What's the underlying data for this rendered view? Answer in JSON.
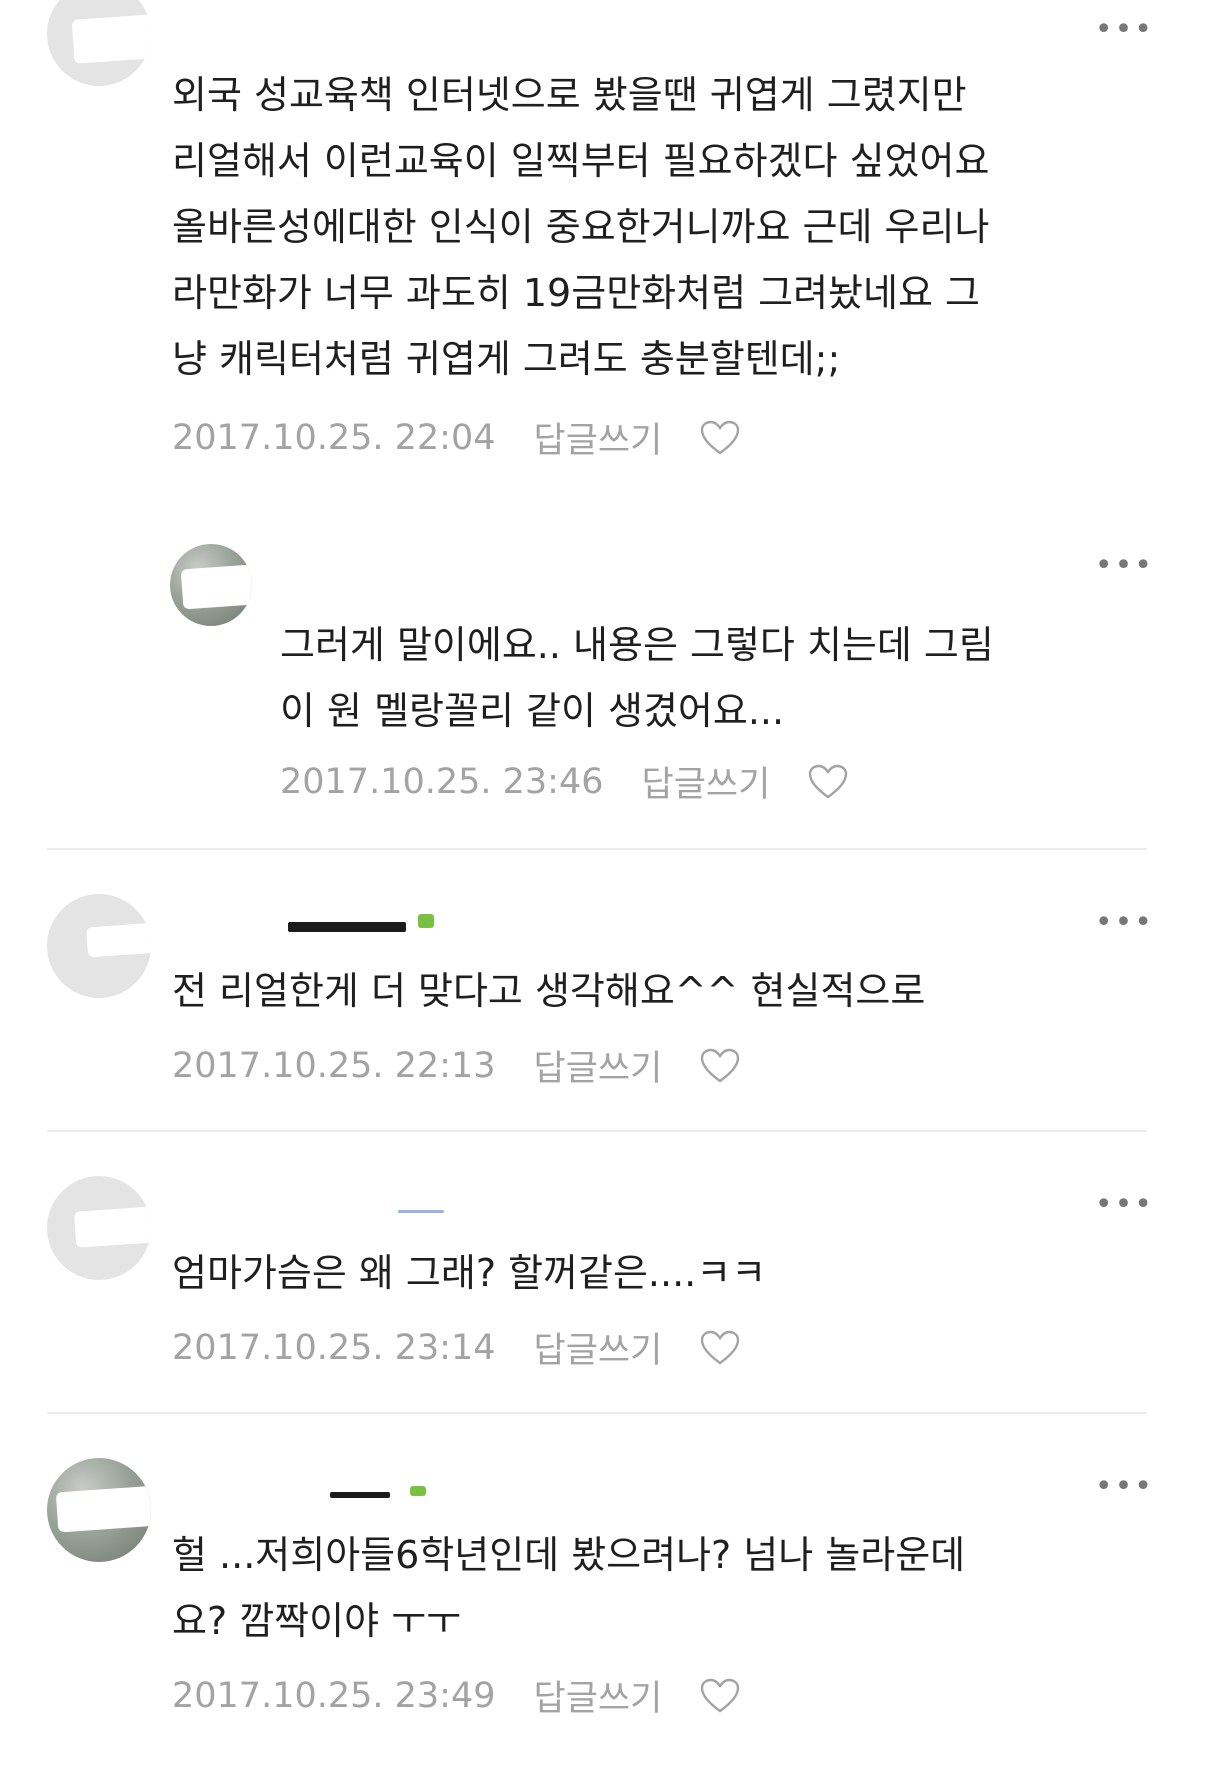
{
  "comments": [
    {
      "text": "외국 성교육책 인터넷으로 봤을땐 귀엽게 그렸지만\n리얼해서 이런교육이 일찍부터 필요하겠다 싶었어요\n올바른성에대한 인식이 중요한거니까요 근데 우리나\n라만화가 너무 과도히 19금만화처럼 그려놨네요 그\n냥 캐릭터처럼 귀엽게 그려도 충분할텐데;;",
      "date": "2017.10.25. 22:04",
      "reply_label": "답글쓰기",
      "more_label": "•••"
    },
    {
      "text": "그러게 말이에요.. 내용은 그렇다 치는데 그림\n이 원 멜랑꼴리 같이 생겼어요...",
      "date": "2017.10.25. 23:46",
      "reply_label": "답글쓰기",
      "more_label": "•••"
    },
    {
      "text": "전 리얼한게 더 맞다고 생각해요^^ 현실적으로",
      "date": "2017.10.25. 22:13",
      "reply_label": "답글쓰기",
      "more_label": "•••"
    },
    {
      "text": "엄마가슴은 왜 그래? 할꺼같은....ㅋㅋ",
      "date": "2017.10.25. 23:14",
      "reply_label": "답글쓰기",
      "more_label": "•••"
    },
    {
      "text": "헐 ...저희아들6학년인데 봤으려나? 넘나 놀라운데\n요? 깜짝이야 ㅜㅜ",
      "date": "2017.10.25. 23:49",
      "reply_label": "답글쓰기",
      "more_label": "•••"
    }
  ],
  "colors": {
    "text": "#1f1f1f",
    "meta": "#a3a3a3",
    "divider": "#ebebeb",
    "badge": "#7ac143"
  },
  "icons": {
    "more": "more-dots-icon",
    "like": "heart-outline-icon",
    "avatar": "profile-avatar"
  }
}
